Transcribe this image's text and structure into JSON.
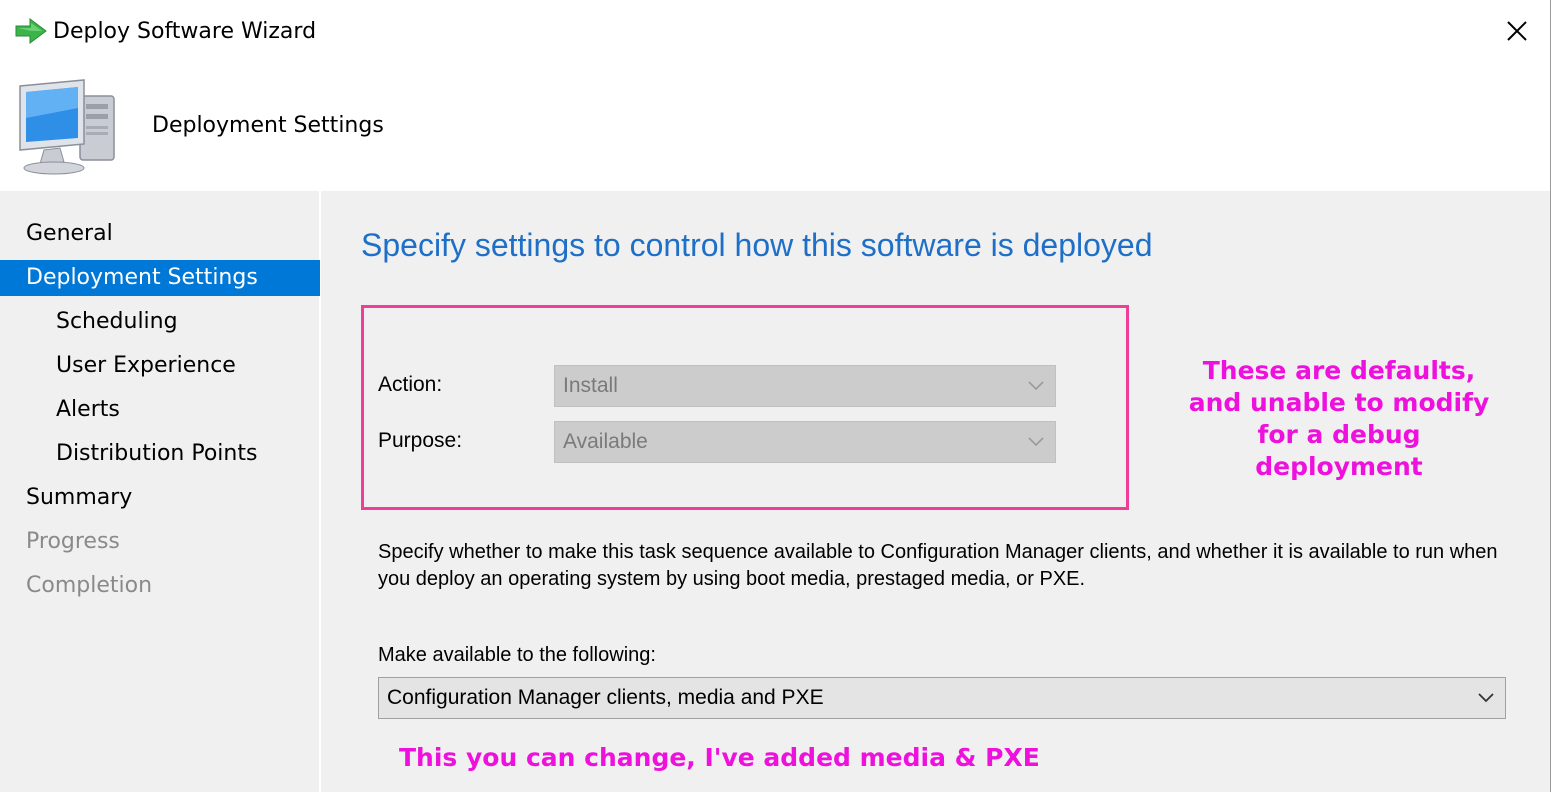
{
  "window": {
    "title": "Deploy Software Wizard",
    "close_icon": "close-icon"
  },
  "header": {
    "title": "Deployment Settings",
    "icon": "computer-icon"
  },
  "nav": {
    "items": [
      {
        "label": "General",
        "level": 1,
        "state": "normal"
      },
      {
        "label": "Deployment Settings",
        "level": 1,
        "state": "selected"
      },
      {
        "label": "Scheduling",
        "level": 2,
        "state": "normal"
      },
      {
        "label": "User Experience",
        "level": 2,
        "state": "normal"
      },
      {
        "label": "Alerts",
        "level": 2,
        "state": "normal"
      },
      {
        "label": "Distribution Points",
        "level": 2,
        "state": "normal"
      },
      {
        "label": "Summary",
        "level": 1,
        "state": "normal"
      },
      {
        "label": "Progress",
        "level": 1,
        "state": "disabled"
      },
      {
        "label": "Completion",
        "level": 1,
        "state": "disabled"
      }
    ]
  },
  "main": {
    "heading": "Specify settings to control how this software is deployed",
    "action": {
      "label": "Action:",
      "value": "Install",
      "enabled": false
    },
    "purpose": {
      "label": "Purpose:",
      "value": "Available",
      "enabled": false
    },
    "description": "Specify whether to make this task sequence available to Configuration Manager clients, and whether it is available to run when you deploy an operating system by using boot media, prestaged media, or PXE.",
    "availability": {
      "label": "Make available to the following:",
      "value": "Configuration Manager clients, media and PXE",
      "enabled": true
    }
  },
  "annotations": {
    "right": "These are defaults, and unable to modify for a debug deployment",
    "bottom": "This you can change, I've added media & PXE",
    "color": "#ee11dd",
    "box_color": "#ef3e97"
  },
  "colors": {
    "accent": "#0078d7",
    "heading": "#1e6fc7"
  }
}
